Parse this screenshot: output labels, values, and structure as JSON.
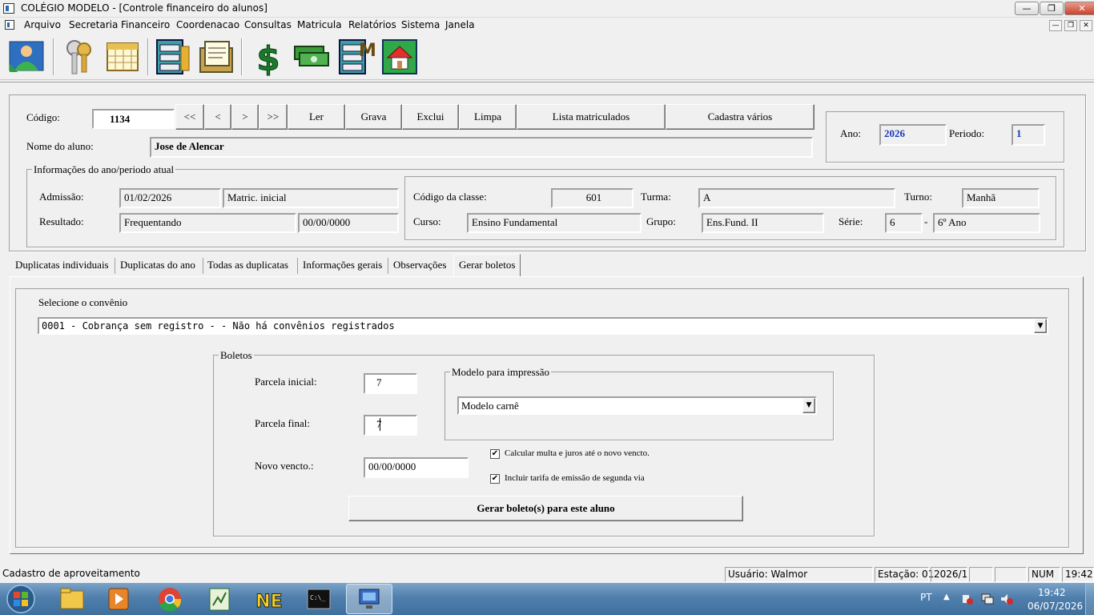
{
  "window": {
    "title": "COLÉGIO MODELO - [Controle financeiro do alunos]",
    "minimize_label": "—",
    "maximize_label": "❐",
    "close_label": "✕"
  },
  "menu": [
    "Arquivo",
    "Secretaria",
    "Financeiro",
    "Coordenacao",
    "Consultas",
    "Matricula",
    "Relatórios",
    "Sistema",
    "Janela"
  ],
  "toolbar_icons": [
    "people-icon",
    "keys-icon",
    "calendar-icon",
    "file-cabinet-icon",
    "documents-icon",
    "dollar-icon",
    "money-stack-icon",
    "cabinet-m-icon",
    "home-icon"
  ],
  "header": {
    "codigo_label": "Código:",
    "codigo_value": "1134",
    "nav": [
      "<<",
      "<",
      ">",
      ">>"
    ],
    "buttons": {
      "ler": "Ler",
      "grava": "Grava",
      "exclui": "Exclui",
      "limpa": "Limpa",
      "lista": "Lista matriculados",
      "cadastra": "Cadastra vários"
    },
    "nome_label": "Nome do aluno:",
    "nome_value": "Jose de Alencar",
    "ano_label": "Ano:",
    "ano_value": "2026",
    "periodo_label": "Periodo:",
    "periodo_value": "1"
  },
  "info": {
    "legend": "Informações do ano/periodo atual",
    "admissao_label": "Admissão:",
    "admissao_value": "01/02/2026",
    "admissao_tipo": "Matric. inicial",
    "resultado_label": "Resultado:",
    "resultado_value": "Frequentando",
    "resultado_data": "00/00/0000",
    "codigo_classe_label": "Código da classe:",
    "codigo_classe_value": "601",
    "turma_label": "Turma:",
    "turma_value": "A",
    "turno_label": "Turno:",
    "turno_value": "Manhã",
    "curso_label": "Curso:",
    "curso_value": "Ensino Fundamental",
    "grupo_label": "Grupo:",
    "grupo_value": "Ens.Fund. II",
    "serie_label": "Série:",
    "serie_value": "6",
    "serie_sep": "-",
    "serie_desc": "6º Ano"
  },
  "tabs": [
    "Duplicatas individuais",
    "Duplicatas do ano",
    "Todas as duplicatas",
    "Informações gerais",
    "Observações",
    "Gerar boletos"
  ],
  "active_tab": "Gerar boletos",
  "gerar": {
    "convenio_label": "Selecione o convênio",
    "convenio_value": "0001 - Cobrança sem registro  -                     - Não há convênios registrados",
    "boletos_legend": "Boletos",
    "parcela_inicial_label": "Parcela inicial:",
    "parcela_inicial_value": "7",
    "parcela_final_label": "Parcela final:",
    "parcela_final_value": "7",
    "novo_vencto_label": "Novo vencto.:",
    "novo_vencto_value": "00/00/0000",
    "modelo_legend": "Modelo para impressão",
    "modelo_value": "Modelo carnê",
    "calc_multa_label": "Calcular multa e juros até o novo vencto.",
    "calc_multa_checked": true,
    "incluir_tarifa_label": "Incluir tarifa de emissão de segunda via",
    "incluir_tarifa_checked": true,
    "gerar_button": "Gerar boleto(s) para este aluno"
  },
  "statusbar": {
    "message": "Cadastro de aproveitamento",
    "usuario": "Usuário: Walmor",
    "estacao": "Estação: 01",
    "periodo": "2026/1",
    "num": "NUM",
    "time": "19:42"
  },
  "taskbar": {
    "apps": [
      "explorer-icon",
      "media-player-icon",
      "chrome-icon",
      "spreadsheet-icon",
      "ne-icon",
      "cmd-icon",
      "network-app-icon"
    ],
    "lang": "PT",
    "clock_time": "19:42",
    "clock_date": "06/07/2026"
  }
}
